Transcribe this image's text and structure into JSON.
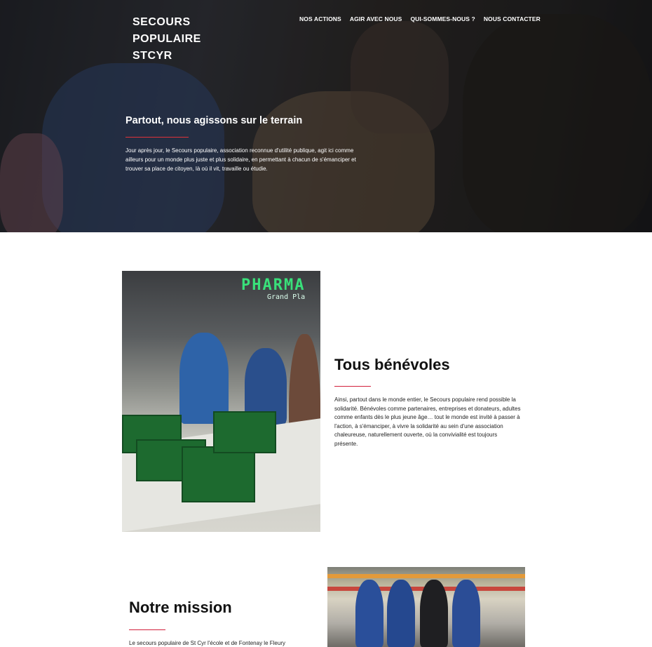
{
  "header": {
    "brand_lines": [
      "SECOURS",
      "POPULAIRE",
      "STCYR"
    ],
    "nav": [
      "NOS ACTIONS",
      "AGIR AVEC NOUS",
      "QUI-SOMMES-NOUS ?",
      "NOUS CONTACTER"
    ]
  },
  "hero": {
    "title": "Partout, nous agissons sur le terrain",
    "text": "Jour après jour, le Secours populaire, association reconnue d'utilité publique, agit ici comme ailleurs pour un monde plus juste et plus solidaire, en permettant à chacun de s'émanciper et trouver sa place de citoyen, là où il vit, travaille ou étudie."
  },
  "section_benevoles": {
    "title": "Tous bénévoles",
    "text": "Ainsi, partout dans le monde entier, le Secours populaire rend possible la solidarité. Bénévoles comme partenaires, entreprises et donateurs, adultes comme enfants dès le plus jeune âge… tout le monde est invité à passer à l'action, à s'émanciper, à vivre la solidarité au sein d'une association chaleureuse, naturellement ouverte, où la convivialité est toujours présente.",
    "photo_sign": "PHARMA",
    "photo_sign_sub": "Grand Pla"
  },
  "section_mission": {
    "title": "Notre mission",
    "text": "Le secours populaire de St Cyr l'école et de Fontenay le Fleury"
  },
  "colors": {
    "accent_rule": "#d21f3c",
    "hero_overlay": "rgba(0,0,0,0.38)"
  }
}
